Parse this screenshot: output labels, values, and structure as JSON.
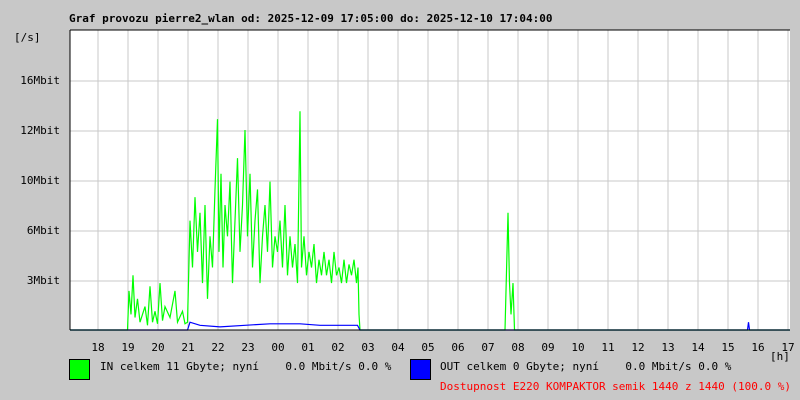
{
  "chart_data": {
    "type": "line",
    "title": "Graf provozu pierre2_wlan od: 2025-12-09 17:05:00 do: 2025-12-10 17:04:00",
    "ylabel": "[/s]",
    "xlabel": "[h]",
    "x_unit": "minutes since 2025-12-09 17:05",
    "xlim": [
      0,
      1440
    ],
    "ylim": [
      0,
      19
    ],
    "y_ticks": [
      {
        "label": "16Mbit",
        "value": 16
      },
      {
        "label": "12Mbit",
        "value": 12.8
      },
      {
        "label": "10Mbit",
        "value": 9.6
      },
      {
        "label": "6Mbit",
        "value": 6.4
      },
      {
        "label": "3Mbit",
        "value": 3.2
      }
    ],
    "x_ticks": [
      "18",
      "19",
      "20",
      "21",
      "22",
      "23",
      "00",
      "01",
      "02",
      "03",
      "04",
      "05",
      "06",
      "07",
      "08",
      "09",
      "10",
      "11",
      "12",
      "13",
      "14",
      "15",
      "16",
      "17"
    ],
    "grid": true,
    "series": [
      {
        "name": "IN",
        "color": "#00ff00",
        "points": [
          [
            0,
            0
          ],
          [
            115,
            0
          ],
          [
            118,
            2.5
          ],
          [
            122,
            1
          ],
          [
            126,
            3.5
          ],
          [
            130,
            0.8
          ],
          [
            135,
            2
          ],
          [
            140,
            0.5
          ],
          [
            150,
            1.5
          ],
          [
            155,
            0.3
          ],
          [
            160,
            2.8
          ],
          [
            165,
            0.5
          ],
          [
            170,
            1.2
          ],
          [
            175,
            0.4
          ],
          [
            180,
            3
          ],
          [
            185,
            0.6
          ],
          [
            190,
            1.5
          ],
          [
            200,
            0.8
          ],
          [
            210,
            2.5
          ],
          [
            215,
            0.5
          ],
          [
            225,
            1.2
          ],
          [
            230,
            0.4
          ],
          [
            235,
            0.5
          ],
          [
            240,
            7
          ],
          [
            245,
            4
          ],
          [
            250,
            8.5
          ],
          [
            255,
            5
          ],
          [
            260,
            7.5
          ],
          [
            265,
            3
          ],
          [
            270,
            8
          ],
          [
            275,
            2
          ],
          [
            280,
            6
          ],
          [
            285,
            4
          ],
          [
            290,
            9
          ],
          [
            295,
            13.5
          ],
          [
            298,
            5
          ],
          [
            302,
            10
          ],
          [
            306,
            4
          ],
          [
            310,
            8
          ],
          [
            315,
            6
          ],
          [
            320,
            9.5
          ],
          [
            325,
            3
          ],
          [
            330,
            7
          ],
          [
            335,
            11
          ],
          [
            340,
            5
          ],
          [
            345,
            8
          ],
          [
            350,
            12.8
          ],
          [
            355,
            6
          ],
          [
            360,
            10
          ],
          [
            365,
            4
          ],
          [
            370,
            7
          ],
          [
            375,
            9
          ],
          [
            380,
            3
          ],
          [
            385,
            6
          ],
          [
            390,
            8
          ],
          [
            395,
            5
          ],
          [
            400,
            9.5
          ],
          [
            405,
            4
          ],
          [
            410,
            6
          ],
          [
            415,
            5
          ],
          [
            420,
            7
          ],
          [
            425,
            4
          ],
          [
            430,
            8
          ],
          [
            435,
            3.5
          ],
          [
            440,
            6
          ],
          [
            445,
            4
          ],
          [
            450,
            5.5
          ],
          [
            455,
            3
          ],
          [
            460,
            14
          ],
          [
            463,
            4
          ],
          [
            468,
            6
          ],
          [
            473,
            3.5
          ],
          [
            478,
            5
          ],
          [
            483,
            4
          ],
          [
            488,
            5.5
          ],
          [
            493,
            3
          ],
          [
            498,
            4.5
          ],
          [
            503,
            3.5
          ],
          [
            508,
            5
          ],
          [
            513,
            3.5
          ],
          [
            518,
            4.5
          ],
          [
            523,
            3
          ],
          [
            528,
            5
          ],
          [
            533,
            3.5
          ],
          [
            538,
            4
          ],
          [
            543,
            3
          ],
          [
            548,
            4.5
          ],
          [
            553,
            3
          ],
          [
            558,
            4.2
          ],
          [
            563,
            3.5
          ],
          [
            568,
            4.5
          ],
          [
            573,
            3
          ],
          [
            576,
            4
          ],
          [
            578,
            1
          ],
          [
            580,
            0
          ],
          [
            870,
            0
          ],
          [
            876,
            7.5
          ],
          [
            879,
            3
          ],
          [
            882,
            1
          ],
          [
            886,
            3
          ],
          [
            889,
            0
          ],
          [
            1440,
            0
          ]
        ]
      },
      {
        "name": "OUT",
        "color": "#0000ff",
        "points": [
          [
            0,
            0
          ],
          [
            235,
            0
          ],
          [
            240,
            0.5
          ],
          [
            260,
            0.3
          ],
          [
            300,
            0.2
          ],
          [
            350,
            0.3
          ],
          [
            400,
            0.4
          ],
          [
            460,
            0.4
          ],
          [
            500,
            0.3
          ],
          [
            575,
            0.3
          ],
          [
            580,
            0
          ],
          [
            1355,
            0
          ],
          [
            1357,
            0.5
          ],
          [
            1359,
            0
          ],
          [
            1440,
            0
          ]
        ]
      }
    ]
  },
  "legend": {
    "in_text": "IN celkem 11 Gbyte; nyní    0.0 Mbit/s 0.0 %",
    "out_text": "OUT celkem 0 Gbyte; nyní    0.0 Mbit/s 0.0 %",
    "in_color": "#00ff00",
    "out_color": "#0000ff"
  },
  "availability": "Dostupnost E220 KOMPAKTOR semik 1440 z 1440 (100.0 %)"
}
